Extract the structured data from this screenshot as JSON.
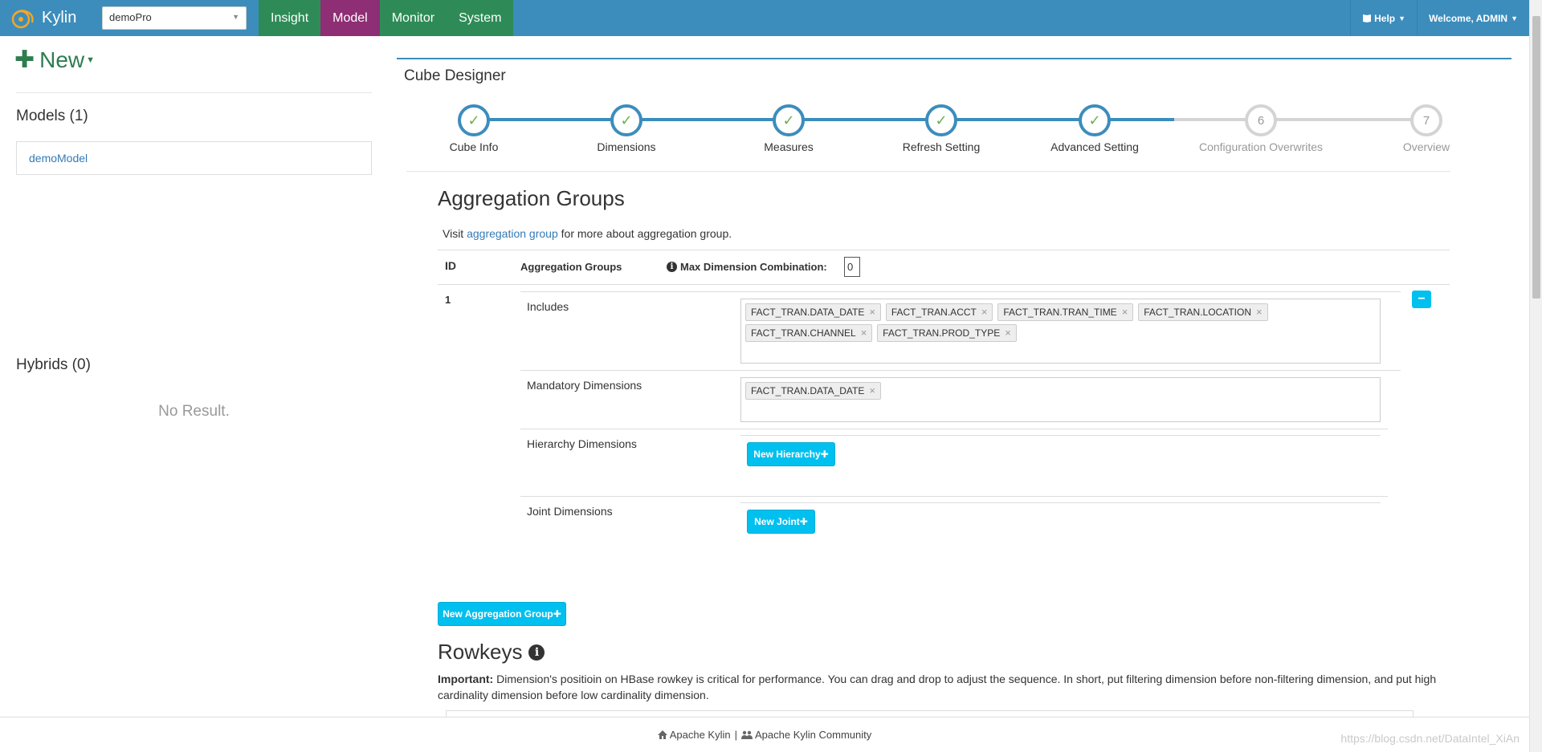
{
  "app": {
    "brand": "Kylin",
    "project": "demoPro"
  },
  "nav": {
    "tabs": [
      {
        "label": "Insight"
      },
      {
        "label": "Model"
      },
      {
        "label": "Monitor"
      },
      {
        "label": "System"
      }
    ],
    "help": "Help",
    "welcome": "Welcome, ADMIN"
  },
  "sidebar": {
    "new_label": "New",
    "models_title": "Models (1)",
    "models": [
      "demoModel"
    ],
    "hybrids_title": "Hybrids (0)",
    "no_result": "No Result."
  },
  "designer": {
    "title": "Cube Designer",
    "steps": [
      {
        "label": "Cube Info",
        "state": "done"
      },
      {
        "label": "Dimensions",
        "state": "done"
      },
      {
        "label": "Measures",
        "state": "done"
      },
      {
        "label": "Refresh Setting",
        "state": "done"
      },
      {
        "label": "Advanced Setting",
        "state": "done"
      },
      {
        "label": "Configuration Overwrites",
        "state": "todo",
        "number": "6"
      },
      {
        "label": "Overview",
        "state": "todo",
        "number": "7"
      }
    ]
  },
  "aggregation": {
    "title": "Aggregation Groups",
    "visit_prefix": "Visit ",
    "visit_link": "aggregation group",
    "visit_suffix": " for more about aggregation group.",
    "col_id": "ID",
    "col_groups": "Aggregation Groups",
    "col_maxdim": "Max Dimension Combination:",
    "maxdim_value": "0",
    "row_id": "1",
    "includes_label": "Includes",
    "includes": [
      "FACT_TRAN.DATA_DATE",
      "FACT_TRAN.ACCT",
      "FACT_TRAN.TRAN_TIME",
      "FACT_TRAN.LOCATION",
      "FACT_TRAN.CHANNEL",
      "FACT_TRAN.PROD_TYPE"
    ],
    "mandatory_label": "Mandatory Dimensions",
    "mandatory": [
      "FACT_TRAN.DATA_DATE"
    ],
    "hierarchy_label": "Hierarchy Dimensions",
    "new_hierarchy": "New Hierarchy",
    "joint_label": "Joint Dimensions",
    "new_joint": "New Joint",
    "new_group": "New Aggregation Group"
  },
  "rowkeys": {
    "title": "Rowkeys",
    "important": "Important:",
    "desc": " Dimension's positioin on HBase rowkey is critical for performance. You can drag and drop to adjust the sequence. In short, put filtering dimension before non-filtering dimension, and put high cardinality dimension before low cardinality dimension."
  },
  "footer": {
    "kylin": "Apache Kylin",
    "sep": "|",
    "community": "Apache Kylin Community",
    "watermark": "https://blog.csdn.net/DataIntel_XiAn"
  },
  "colors": {
    "primary": "#3c8dbc",
    "model_tab": "#8e2e74",
    "nav_tab": "#2e8b57",
    "accent": "#00c0ef",
    "done_check": "#6ab04c"
  }
}
